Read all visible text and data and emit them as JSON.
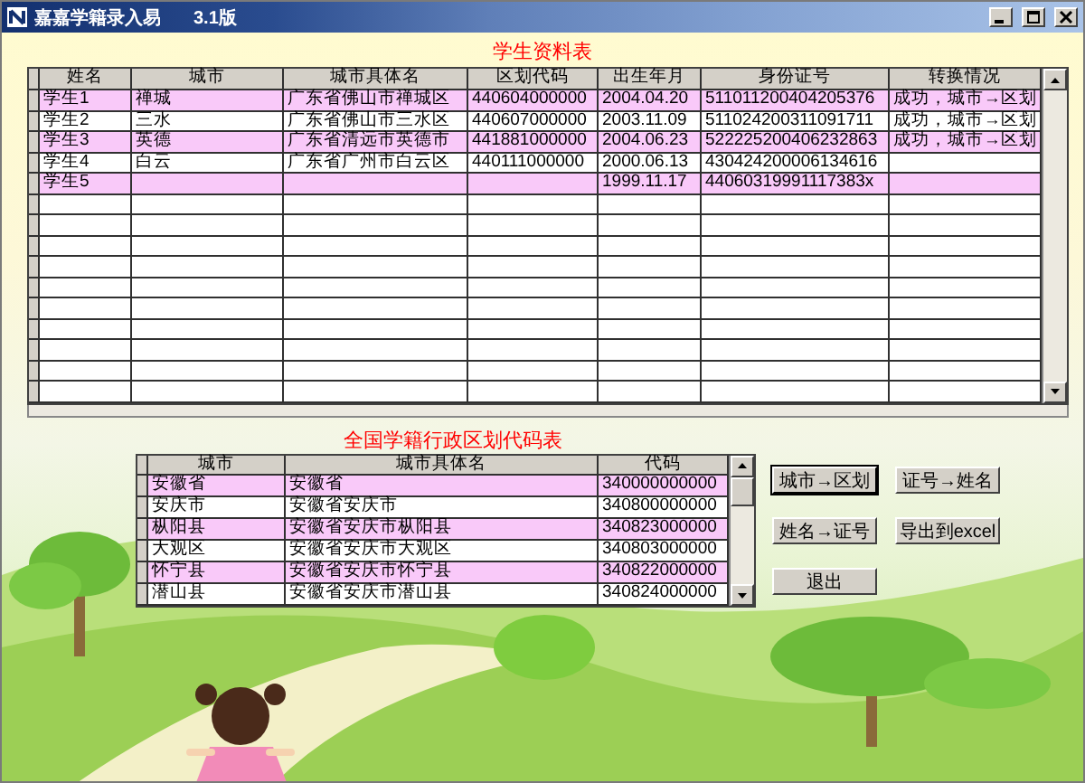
{
  "window": {
    "title": "嘉嘉学籍录入易",
    "version": "3.1版"
  },
  "student_table": {
    "title": "学生资料表",
    "columns": [
      "姓名",
      "城市",
      "城市具体名",
      "区划代码",
      "出生年月",
      "身份证号",
      "转换情况"
    ],
    "rows": [
      [
        "学生1",
        "禅城",
        "广东省佛山市禅城区",
        "440604000000",
        "2004.04.20",
        "511011200404205376",
        "成功，城市→区划"
      ],
      [
        "学生2",
        "三水",
        "广东省佛山市三水区",
        "440607000000",
        "2003.11.09",
        "511024200311091711",
        "成功，城市→区划"
      ],
      [
        "学生3",
        "英德",
        "广东省清远市英德市",
        "441881000000",
        "2004.06.23",
        "522225200406232863",
        "成功，城市→区划"
      ],
      [
        "学生4",
        "白云",
        "广东省广州市白云区",
        "440111000000",
        "2000.06.13",
        "430424200006134616",
        ""
      ],
      [
        "学生5",
        "",
        "",
        "",
        "1999.11.17",
        "44060319991117383x",
        ""
      ]
    ]
  },
  "region_table": {
    "title": "全国学籍行政区划代码表",
    "columns": [
      "城市",
      "城市具体名",
      "代码"
    ],
    "rows": [
      [
        "安徽省",
        "安徽省",
        "340000000000"
      ],
      [
        "安庆市",
        "安徽省安庆市",
        "340800000000"
      ],
      [
        "枞阳县",
        "安徽省安庆市枞阳县",
        "340823000000"
      ],
      [
        "大观区",
        "安徽省安庆市大观区",
        "340803000000"
      ],
      [
        "怀宁县",
        "安徽省安庆市怀宁县",
        "340822000000"
      ],
      [
        "潜山县",
        "安徽省安庆市潜山县",
        "340824000000"
      ]
    ]
  },
  "buttons": [
    {
      "label": "城市→区划",
      "focused": true
    },
    {
      "label": "证号→姓名",
      "focused": false
    },
    {
      "label": "姓名→证号",
      "focused": false
    },
    {
      "label": "导出到excel",
      "focused": false
    },
    {
      "label": "退出",
      "focused": false
    }
  ]
}
